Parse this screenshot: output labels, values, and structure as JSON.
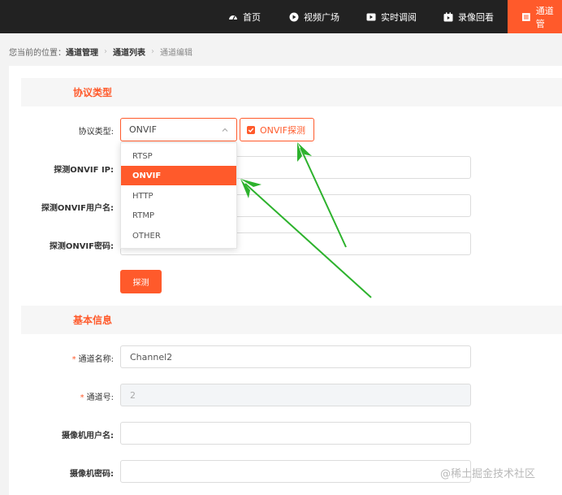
{
  "nav": {
    "items": [
      {
        "label": "首页",
        "icon": "dashboard-icon"
      },
      {
        "label": "视频广场",
        "icon": "play-circle-icon"
      },
      {
        "label": "实时调阅",
        "icon": "video-play-icon"
      },
      {
        "label": "录像回看",
        "icon": "playback-icon"
      },
      {
        "label": "通道管",
        "icon": "list-icon"
      }
    ]
  },
  "breadcrumb": {
    "prefix": "您当前的位置：",
    "items": [
      "通道管理",
      "通道列表",
      "通道编辑"
    ]
  },
  "protocol_section": {
    "title": "协议类型",
    "protocol_label": "协议类型:",
    "protocol_value": "ONVIF",
    "onvif_detect_label": "ONVIF探测",
    "onvif_ip_label": "探测ONVIF IP:",
    "onvif_user_label": "探测ONVIF用户名:",
    "onvif_pass_label": "探测ONVIF密码:",
    "detect_button": "探测",
    "options": [
      "RTSP",
      "ONVIF",
      "HTTP",
      "RTMP",
      "OTHER"
    ],
    "selected_option": "ONVIF"
  },
  "basic_section": {
    "title": "基本信息",
    "channel_name_label": "通道名称:",
    "channel_name_value": "Channel2",
    "channel_no_label": "通道号:",
    "channel_no_value": "2",
    "camera_user_label": "摄像机用户名:",
    "camera_pass_label": "摄像机密码:"
  },
  "watermark": "@稀土掘金技术社区",
  "colors": {
    "accent": "#ff5a2b",
    "topbar": "#222222",
    "annotation_arrow": "#2db22d"
  }
}
